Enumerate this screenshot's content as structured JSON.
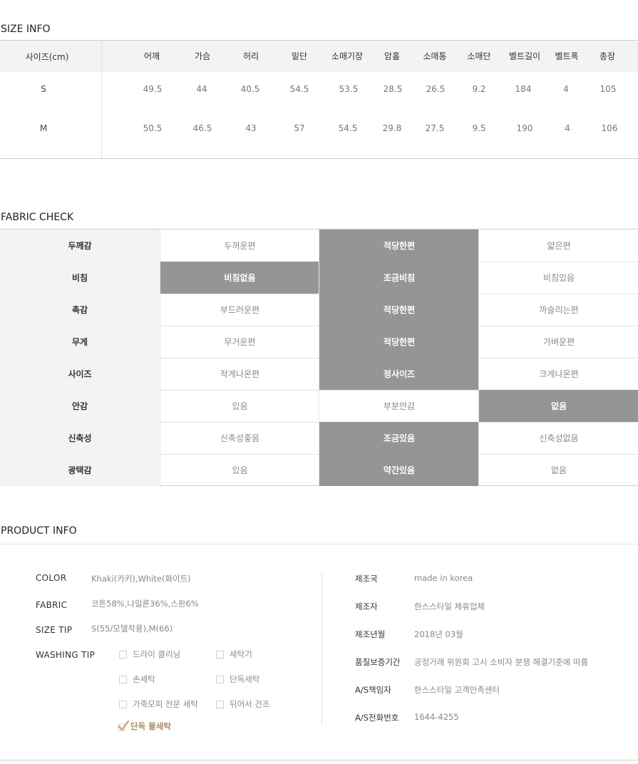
{
  "size_info": {
    "title": "SIZE INFO",
    "header_label": "사이즈(cm)",
    "columns": [
      "어깨",
      "가슴",
      "허리",
      "밑단",
      "소매기장",
      "암홀",
      "소매통",
      "소매단",
      "벨트길이",
      "벨트폭",
      "총장"
    ],
    "rows": [
      {
        "size": "S",
        "values": [
          "49.5",
          "44",
          "40.5",
          "54.5",
          "53.5",
          "28.5",
          "26.5",
          "9.2",
          "184",
          "4",
          "105"
        ]
      },
      {
        "size": "M",
        "values": [
          "50.5",
          "46.5",
          "43",
          "57",
          "54.5",
          "29.8",
          "27.5",
          "9.5",
          "190",
          "4",
          "106"
        ]
      }
    ]
  },
  "fabric_check": {
    "title": "FABRIC CHECK",
    "rows": [
      {
        "label": "두께감",
        "options": [
          "두꺼운편",
          "적당한편",
          "얇은편"
        ],
        "selected": 1
      },
      {
        "label": "비침",
        "options": [
          "비침없음",
          "조금비침",
          "비침있음"
        ],
        "selected": 0,
        "also_selected": 1
      },
      {
        "label": "촉감",
        "options": [
          "부드러운편",
          "적당한편",
          "까슬리는편"
        ],
        "selected": 1
      },
      {
        "label": "무게",
        "options": [
          "무거운편",
          "적당한편",
          "가벼운편"
        ],
        "selected": 1
      },
      {
        "label": "사이즈",
        "options": [
          "작게나온편",
          "정사이즈",
          "크게나온편"
        ],
        "selected": 1
      },
      {
        "label": "안감",
        "options": [
          "있음",
          "부분안감",
          "없음"
        ],
        "selected": 2
      },
      {
        "label": "신축성",
        "options": [
          "신축성좋음",
          "조금있음",
          "신축성없음"
        ],
        "selected": 1
      },
      {
        "label": "광택감",
        "options": [
          "있음",
          "약간있음",
          "없음"
        ],
        "selected": 1
      }
    ]
  },
  "product_info": {
    "title": "PRODUCT INFO",
    "left": {
      "color_label": "COLOR",
      "color_value": "Khaki(카키),White(화이트)",
      "fabric_label": "FABRIC",
      "fabric_value": "코튼58%,나일론36%,스판6%",
      "size_tip_label": "SIZE TIP",
      "size_tip_value": "S(55/모델착용),M(66)",
      "washing_label": "WASHING TIP",
      "washing_options": [
        "드라이 클리닝",
        "세탁기",
        "손세탁",
        "단독세탁",
        "가죽모피 전문 세탁",
        "뒤어서 건조",
        "단독 물세탁"
      ],
      "washing_checked": "단독 물세탁"
    },
    "right": [
      {
        "label": "제조국",
        "value": "made in korea"
      },
      {
        "label": "제조자",
        "value": "한스스타일 제휴업체"
      },
      {
        "label": "제조년월",
        "value": "2018년 03월"
      },
      {
        "label": "품질보증기간",
        "value": "공정거래 위원회 고시 소비자 분쟁 해결기준에 따름"
      },
      {
        "label": "A/S책임자",
        "value": "한스스타일 고객만족센터"
      },
      {
        "label": "A/S전화번호",
        "value": "1644-4255"
      }
    ]
  },
  "colors": {
    "selected_bg": "#959595",
    "header_bg": "#f3f3f3",
    "check_color": "#a88b6a"
  }
}
